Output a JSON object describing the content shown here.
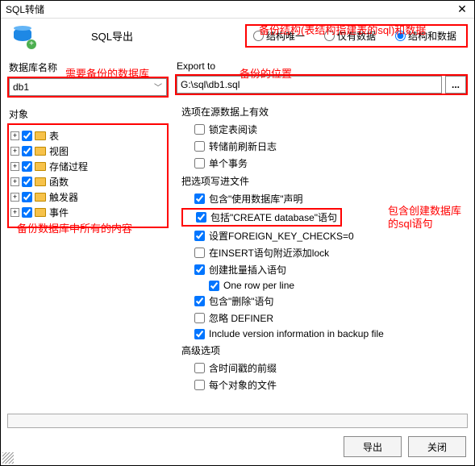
{
  "window": {
    "title": "SQL转储"
  },
  "header": {
    "label": "SQL导出"
  },
  "export_mode": {
    "structure_only": "结构唯一",
    "data_only": "仅有数据",
    "structure_and_data": "结构和数据",
    "selected": "structure_and_data"
  },
  "labels": {
    "database_name": "数据库名称",
    "export_to": "Export to",
    "object": "对象"
  },
  "database": {
    "selected": "db1"
  },
  "export_path": {
    "value": "G:\\sql\\db1.sql"
  },
  "tree": {
    "items": [
      {
        "label": "表"
      },
      {
        "label": "视图"
      },
      {
        "label": "存储过程"
      },
      {
        "label": "函数"
      },
      {
        "label": "触发器"
      },
      {
        "label": "事件"
      }
    ]
  },
  "options": {
    "group1_title": "选项在源数据上有效",
    "g1": [
      {
        "label": "锁定表阅读",
        "checked": false
      },
      {
        "label": "转储前刷新日志",
        "checked": false
      },
      {
        "label": "单个事务",
        "checked": false
      }
    ],
    "group2_title": "把选项写进文件",
    "g2": [
      {
        "label": "包含\"使用数据库\"声明",
        "checked": true
      },
      {
        "label": "包括\"CREATE database\"语句",
        "checked": true,
        "hl": true
      },
      {
        "label": "设置FOREIGN_KEY_CHECKS=0",
        "checked": true
      },
      {
        "label": "在INSERT语句附近添加lock",
        "checked": false
      },
      {
        "label": "创建批量插入语句",
        "checked": true
      },
      {
        "label": "One row per line",
        "checked": true,
        "indent": true
      },
      {
        "label": "包含\"删除\"语句",
        "checked": true
      },
      {
        "label": "忽略 DEFINER",
        "checked": false
      },
      {
        "label": "Include version information in backup file",
        "checked": true
      }
    ],
    "group3_title": "高级选项",
    "g3": [
      {
        "label": "含时间戳的前缀",
        "checked": false
      },
      {
        "label": "每个对象的文件",
        "checked": false
      }
    ]
  },
  "buttons": {
    "export": "导出",
    "close": "关闭",
    "browse": "..."
  },
  "annotations": {
    "a1": "备份结构(表结构指建表的sql)和数据",
    "a2": "需要备份的数据库",
    "a3": "备份的位置",
    "a4": "备份数据库中所有的内容",
    "a5a": "包含创建数据库",
    "a5b": "的sql语句"
  }
}
